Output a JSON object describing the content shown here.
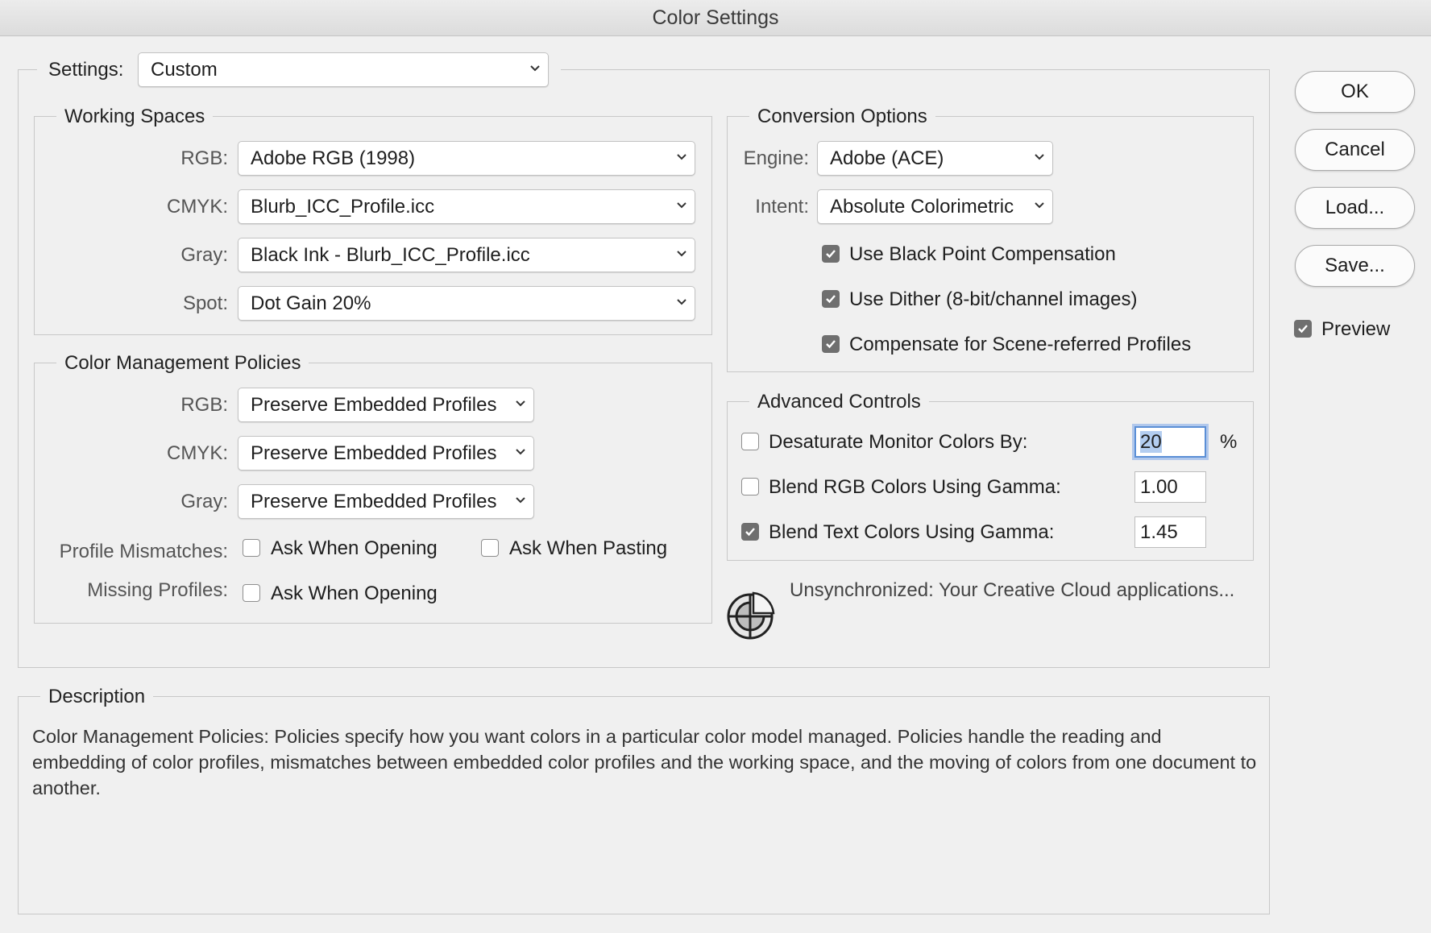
{
  "window": {
    "title": "Color Settings"
  },
  "settings": {
    "label": "Settings:",
    "value": "Custom"
  },
  "working_spaces": {
    "title": "Working Spaces",
    "rgb": {
      "label": "RGB:",
      "value": "Adobe RGB (1998)"
    },
    "cmyk": {
      "label": "CMYK:",
      "value": "Blurb_ICC_Profile.icc"
    },
    "gray": {
      "label": "Gray:",
      "value": "Black Ink - Blurb_ICC_Profile.icc"
    },
    "spot": {
      "label": "Spot:",
      "value": "Dot Gain 20%"
    }
  },
  "policies": {
    "title": "Color Management Policies",
    "rgb": {
      "label": "RGB:",
      "value": "Preserve Embedded Profiles"
    },
    "cmyk": {
      "label": "CMYK:",
      "value": "Preserve Embedded Profiles"
    },
    "gray": {
      "label": "Gray:",
      "value": "Preserve Embedded Profiles"
    },
    "mismatches_label": "Profile Mismatches:",
    "ask_opening": {
      "label": "Ask When Opening",
      "checked": false
    },
    "ask_pasting": {
      "label": "Ask When Pasting",
      "checked": false
    },
    "missing_label": "Missing Profiles:",
    "missing_ask_opening": {
      "label": "Ask When Opening",
      "checked": false
    }
  },
  "conversion": {
    "title": "Conversion Options",
    "engine": {
      "label": "Engine:",
      "value": "Adobe (ACE)"
    },
    "intent": {
      "label": "Intent:",
      "value": "Absolute Colorimetric"
    },
    "black_point": {
      "label": "Use Black Point Compensation",
      "checked": true
    },
    "dither": {
      "label": "Use Dither (8-bit/channel images)",
      "checked": true
    },
    "scene_referred": {
      "label": "Compensate for Scene-referred Profiles",
      "checked": true
    }
  },
  "advanced": {
    "title": "Advanced Controls",
    "desaturate": {
      "label": "Desaturate Monitor Colors By:",
      "checked": false,
      "value": "20",
      "unit": "%"
    },
    "blend_rgb": {
      "label": "Blend RGB Colors Using Gamma:",
      "checked": false,
      "value": "1.00"
    },
    "blend_text": {
      "label": "Blend Text Colors Using Gamma:",
      "checked": true,
      "value": "1.45"
    }
  },
  "sync": {
    "icon": "sync-status-icon",
    "text": "Unsynchronized: Your Creative Cloud applications..."
  },
  "buttons": {
    "ok": "OK",
    "cancel": "Cancel",
    "load": "Load...",
    "save": "Save..."
  },
  "preview": {
    "label": "Preview",
    "checked": true
  },
  "description": {
    "title": "Description",
    "text": "Color Management Policies:  Policies specify how you want colors in a particular color model managed.  Policies handle the reading and embedding of color profiles, mismatches between embedded color profiles and the working space, and the moving of colors from one document to another."
  },
  "colors": {
    "focus_ring": "#5b8fd6",
    "checkbox_on": "#6f6f6f",
    "dialog_bg": "#f0f0f0"
  }
}
